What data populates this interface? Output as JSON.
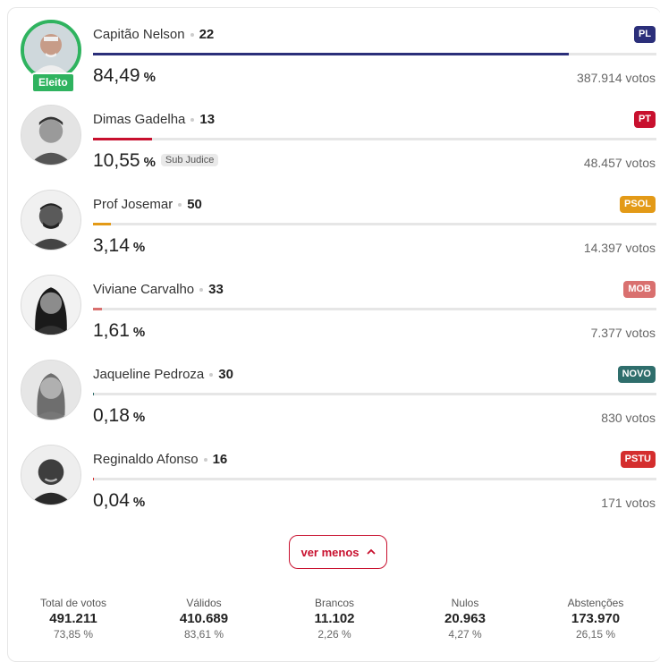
{
  "candidates": [
    {
      "name": "Capitão Nelson",
      "number": "22",
      "party": "PL",
      "party_color": "#2b2f7a",
      "bar_color": "#2b2f7a",
      "pct": "84,49",
      "pct_value": 84.49,
      "votes": "387.914 votos",
      "elected": "Eleito",
      "badge": ""
    },
    {
      "name": "Dimas Gadelha",
      "number": "13",
      "party": "PT",
      "party_color": "#c8102e",
      "bar_color": "#c8102e",
      "pct": "10,55",
      "pct_value": 10.55,
      "votes": "48.457 votos",
      "elected": "",
      "badge": "Sub Judice"
    },
    {
      "name": "Prof Josemar",
      "number": "50",
      "party": "PSOL",
      "party_color": "#e39a17",
      "bar_color": "#e39a17",
      "pct": "3,14",
      "pct_value": 3.14,
      "votes": "14.397 votos",
      "elected": "",
      "badge": ""
    },
    {
      "name": "Viviane Carvalho",
      "number": "33",
      "party": "MOB",
      "party_color": "#d9706f",
      "bar_color": "#d9706f",
      "pct": "1,61",
      "pct_value": 1.61,
      "votes": "7.377 votos",
      "elected": "",
      "badge": ""
    },
    {
      "name": "Jaqueline Pedroza",
      "number": "30",
      "party": "NOVO",
      "party_color": "#2f6e6c",
      "bar_color": "#2f6e6c",
      "pct": "0,18",
      "pct_value": 0.18,
      "votes": "830 votos",
      "elected": "",
      "badge": ""
    },
    {
      "name": "Reginaldo Afonso",
      "number": "16",
      "party": "PSTU",
      "party_color": "#d42e2e",
      "bar_color": "#d42e2e",
      "pct": "0,04",
      "pct_value": 0.04,
      "votes": "171 votos",
      "elected": "",
      "badge": ""
    }
  ],
  "percent_unit": "%",
  "toggle": {
    "label": "ver menos",
    "icon": "chevron-up-icon"
  },
  "stats": [
    {
      "label": "Total de votos",
      "value": "491.211",
      "pct": "73,85 %"
    },
    {
      "label": "Válidos",
      "value": "410.689",
      "pct": "83,61 %"
    },
    {
      "label": "Brancos",
      "value": "11.102",
      "pct": "2,26 %"
    },
    {
      "label": "Nulos",
      "value": "20.963",
      "pct": "4,27 %"
    },
    {
      "label": "Abstenções",
      "value": "173.970",
      "pct": "26,15 %"
    }
  ]
}
